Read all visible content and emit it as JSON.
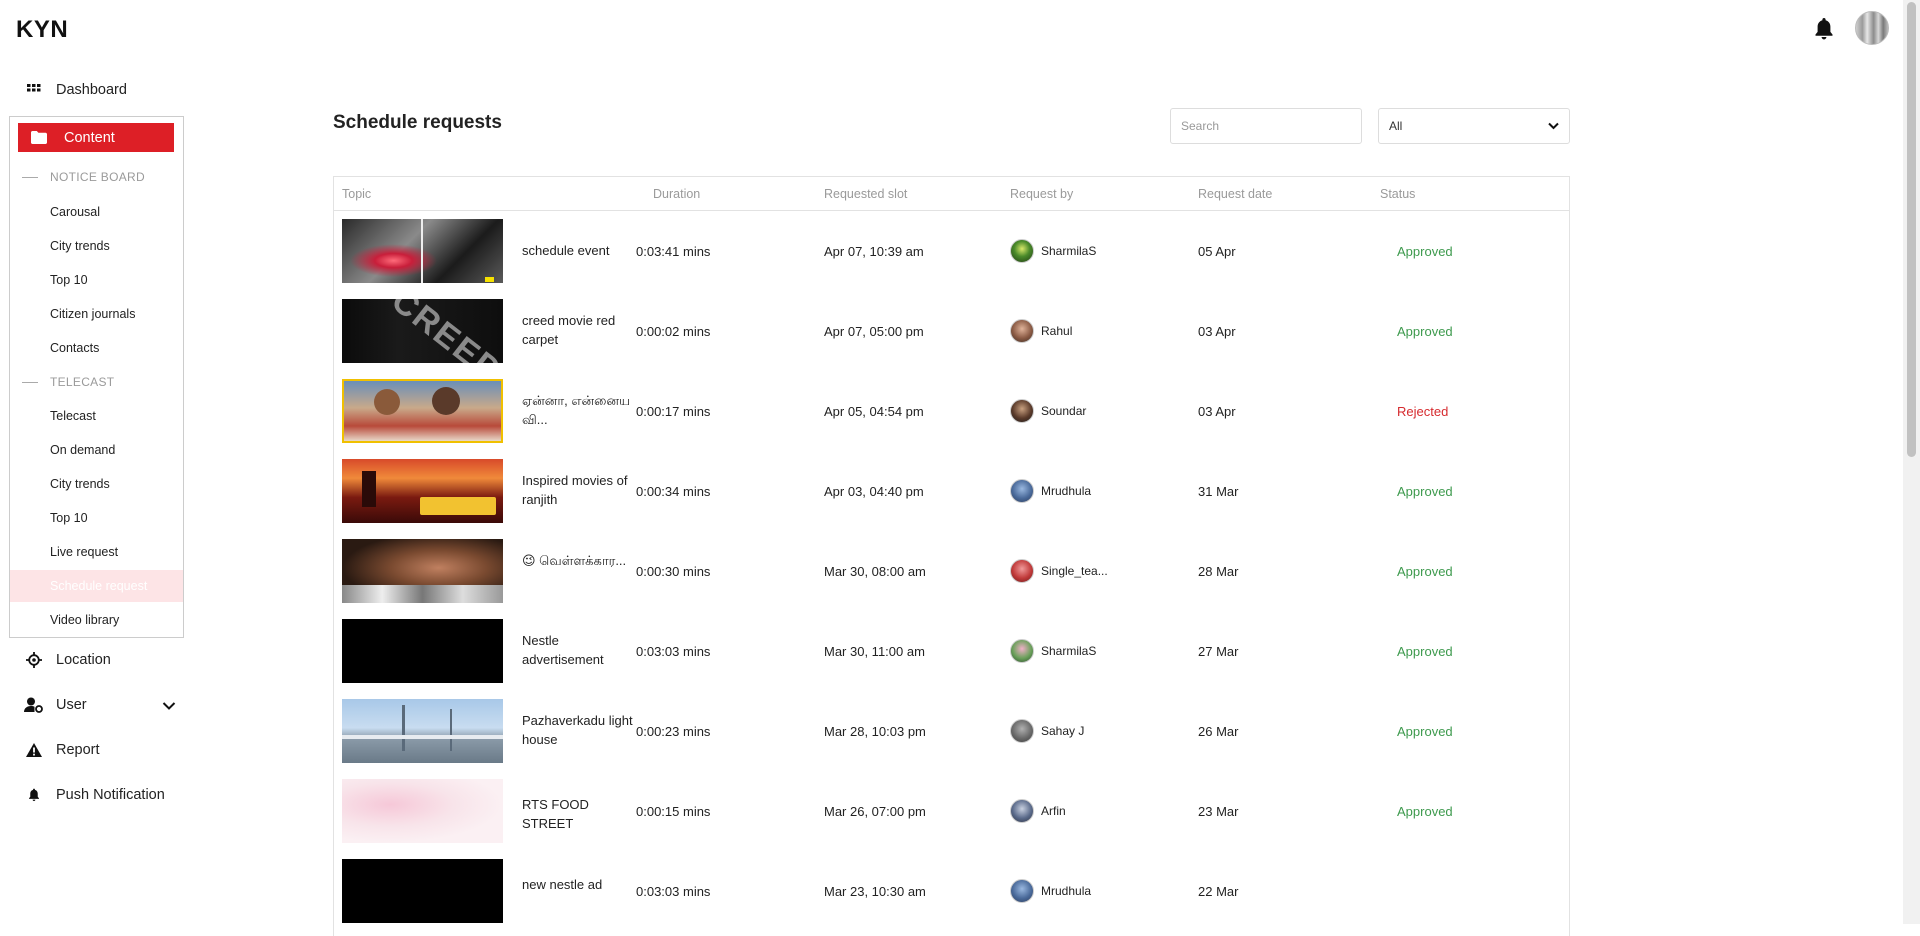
{
  "app": {
    "logo": "KYN"
  },
  "header": {
    "bell_icon": "bell-icon",
    "avatar": "user-avatar"
  },
  "sidebar": {
    "dashboard": {
      "label": "Dashboard",
      "icon": "grid-icon"
    },
    "content": {
      "label": "Content",
      "icon": "folder-icon"
    },
    "notice_board": {
      "heading": "NOTICE BOARD",
      "items": [
        "Carousal",
        "City trends",
        "Top 10",
        "Citizen journals",
        "Contacts"
      ]
    },
    "telecast": {
      "heading": "TELECAST",
      "items": [
        "Telecast",
        "On demand",
        "City trends",
        "Top 10",
        "Live request",
        "Schedule request",
        "Video library"
      ],
      "active": "Schedule request"
    },
    "location": {
      "label": "Location",
      "icon": "crosshair-icon"
    },
    "user": {
      "label": "User",
      "icon": "user-settings-icon",
      "chevron": "chevron-down-icon"
    },
    "report": {
      "label": "Report",
      "icon": "warning-icon"
    },
    "push": {
      "label": "Push Notification",
      "icon": "bell-icon"
    }
  },
  "main": {
    "title": "Schedule requests",
    "search_placeholder": "Search",
    "filter_value": "All",
    "columns": [
      "Topic",
      "Duration",
      "Requested slot",
      "Request by",
      "Request date",
      "Status"
    ],
    "rows": [
      {
        "topic": "schedule event",
        "duration": "0:03:41 mins",
        "slot": "Apr 07, 10:39 am",
        "by": "SharmilaS",
        "date": "05 Apr",
        "status": "Approved"
      },
      {
        "topic": "creed movie red carpet",
        "duration": "0:00:02 mins",
        "slot": "Apr 07, 05:00 pm",
        "by": "Rahul",
        "date": "03 Apr",
        "status": "Approved"
      },
      {
        "topic": "ஏன்னா, என்னைய வி...",
        "duration": "0:00:17 mins",
        "slot": "Apr 05, 04:54 pm",
        "by": "Soundar",
        "date": "03 Apr",
        "status": "Rejected"
      },
      {
        "topic": "Inspired movies of ranjith",
        "duration": "0:00:34 mins",
        "slot": "Apr 03, 04:40 pm",
        "by": "Mrudhula",
        "date": "31 Mar",
        "status": "Approved"
      },
      {
        "topic": "😉 வெள்ளக்கார...",
        "duration": "0:00:30 mins",
        "slot": "Mar 30, 08:00 am",
        "by": "Single_tea...",
        "date": "28 Mar",
        "status": "Approved"
      },
      {
        "topic": "Nestle advertisement",
        "duration": "0:03:03 mins",
        "slot": "Mar 30, 11:00 am",
        "by": "SharmilaS",
        "date": "27 Mar",
        "status": "Approved"
      },
      {
        "topic": "Pazhaverkadu light house",
        "duration": "0:00:23 mins",
        "slot": "Mar 28, 10:03 pm",
        "by": "Sahay J",
        "date": "26 Mar",
        "status": "Approved"
      },
      {
        "topic": "RTS FOOD STREET",
        "duration": "0:00:15 mins",
        "slot": "Mar 26, 07:00 pm",
        "by": "Arfin",
        "date": "23 Mar",
        "status": "Approved"
      },
      {
        "topic": "new nestle ad",
        "duration": "0:03:03 mins",
        "slot": "Mar 23, 10:30 am",
        "by": "Mrudhula",
        "date": "22 Mar",
        "status": ""
      }
    ]
  },
  "colors": {
    "accent": "#dd1f26",
    "approved": "#3e9a4e",
    "rejected": "#d62b2f",
    "active_bg": "#fde4e6"
  }
}
